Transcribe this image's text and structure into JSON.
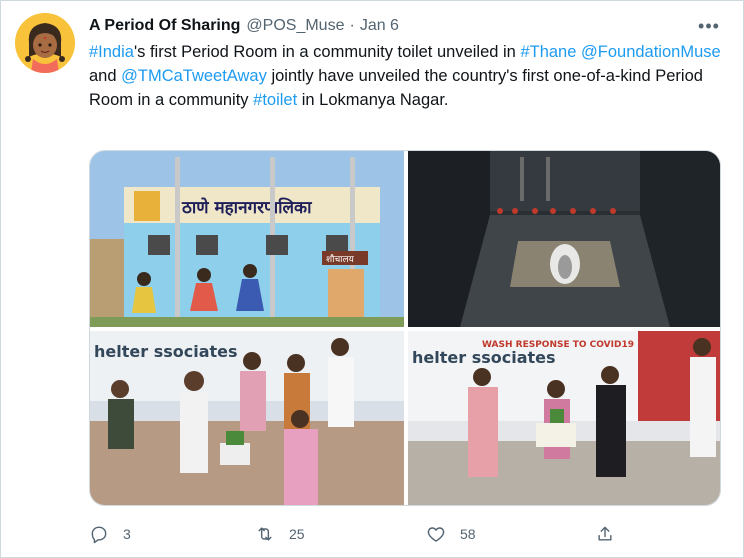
{
  "tweet": {
    "author_name": "A Period Of Sharing",
    "author_handle": "@POS_Muse",
    "separator": "·",
    "date": "Jan 6",
    "more_label": "•••",
    "text_segments": [
      {
        "text": "#India",
        "link": true
      },
      {
        "text": "'s first Period Room in a community toilet unveiled in ",
        "link": false
      },
      {
        "text": "#Thane",
        "link": true
      },
      {
        "text": " ",
        "link": false
      },
      {
        "text": "@FoundationMuse",
        "link": true
      },
      {
        "text": " and ",
        "link": false
      },
      {
        "text": "@TMCaTweetAway",
        "link": true
      },
      {
        "text": " jointly have unveiled the country's first one-of-a-kind Period Room in a community ",
        "link": false
      },
      {
        "text": "#toilet",
        "link": true
      },
      {
        "text": " in Lokmanya Nagar.",
        "link": false
      }
    ],
    "photos": {
      "mural_sign": "ठाणे महानगरपालिका",
      "toilet_sign": "शौचालय",
      "banner_left": "helter ssociates",
      "banner_right_title": "WASH RESPONSE TO COVID19",
      "banner_right_org": "helter ssociates"
    },
    "actions": {
      "reply_count": "3",
      "retweet_count": "25",
      "like_count": "58"
    }
  },
  "colors": {
    "link": "#1d9bf0",
    "secondary_text": "#536471",
    "border": "#cfd9de"
  },
  "icons": {
    "avatar": "cartoon-girl-avatar",
    "more": "more-dots-icon",
    "reply": "reply-icon",
    "retweet": "retweet-icon",
    "like": "heart-icon",
    "share": "share-icon"
  }
}
